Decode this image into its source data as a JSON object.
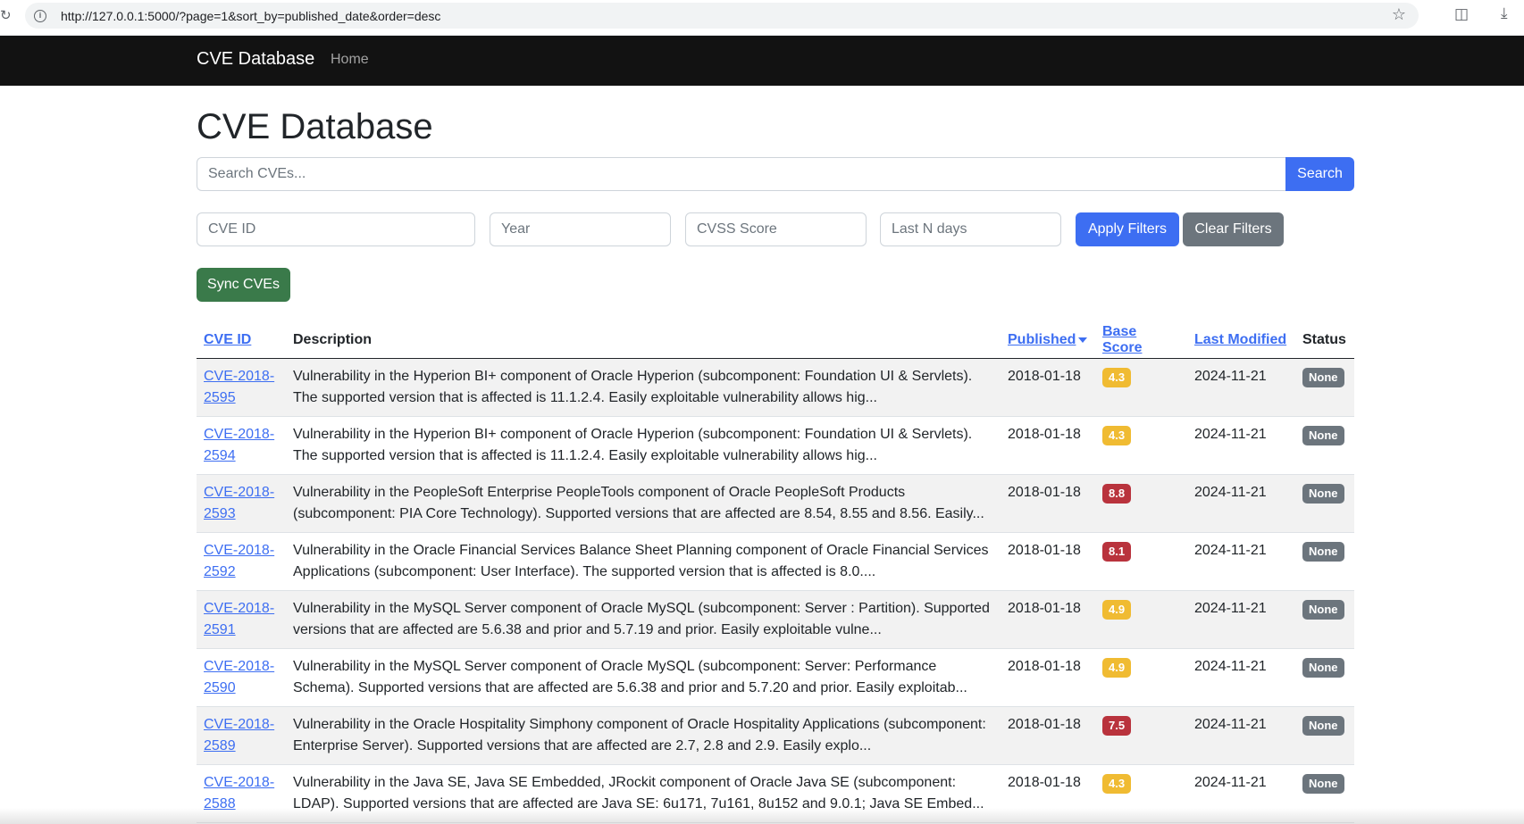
{
  "browser": {
    "url": "http://127.0.0.1:5000/?page=1&sort_by=published_date&order=desc"
  },
  "navbar": {
    "brand": "CVE Database",
    "home": "Home"
  },
  "page": {
    "title": "CVE Database"
  },
  "search": {
    "placeholder": "Search CVEs...",
    "button": "Search"
  },
  "filters": {
    "cve_id_placeholder": "CVE ID",
    "year_placeholder": "Year",
    "cvss_placeholder": "CVSS Score",
    "days_placeholder": "Last N days",
    "apply": "Apply Filters",
    "clear": "Clear Filters"
  },
  "sync": {
    "label": "Sync CVEs"
  },
  "table": {
    "headers": {
      "cve_id": "CVE ID",
      "description": "Description",
      "published": "Published",
      "base_score": "Base Score",
      "last_modified": "Last Modified",
      "status": "Status"
    },
    "rows": [
      {
        "id_a": "CVE-2018-",
        "id_b": "2595",
        "description": "Vulnerability in the Hyperion BI+ component of Oracle Hyperion (subcomponent: Foundation UI & Servlets). The supported version that is affected is 11.1.2.4. Easily exploitable vulnerability allows hig...",
        "published": "2018-01-18",
        "score": "4.3",
        "severity": "warn",
        "modified": "2024-11-21",
        "status": "None"
      },
      {
        "id_a": "CVE-2018-",
        "id_b": "2594",
        "description": "Vulnerability in the Hyperion BI+ component of Oracle Hyperion (subcomponent: Foundation UI & Servlets). The supported version that is affected is 11.1.2.4. Easily exploitable vulnerability allows hig...",
        "published": "2018-01-18",
        "score": "4.3",
        "severity": "warn",
        "modified": "2024-11-21",
        "status": "None"
      },
      {
        "id_a": "CVE-2018-",
        "id_b": "2593",
        "description": "Vulnerability in the PeopleSoft Enterprise PeopleTools component of Oracle PeopleSoft Products (subcomponent: PIA Core Technology). Supported versions that are affected are 8.54, 8.55 and 8.56. Easily...",
        "published": "2018-01-18",
        "score": "8.8",
        "severity": "danger",
        "modified": "2024-11-21",
        "status": "None"
      },
      {
        "id_a": "CVE-2018-",
        "id_b": "2592",
        "description": "Vulnerability in the Oracle Financial Services Balance Sheet Planning component of Oracle Financial Services Applications (subcomponent: User Interface). The supported version that is affected is 8.0....",
        "published": "2018-01-18",
        "score": "8.1",
        "severity": "danger",
        "modified": "2024-11-21",
        "status": "None"
      },
      {
        "id_a": "CVE-2018-",
        "id_b": "2591",
        "description": "Vulnerability in the MySQL Server component of Oracle MySQL (subcomponent: Server : Partition). Supported versions that are affected are 5.6.38 and prior and 5.7.19 and prior. Easily exploitable vulne...",
        "published": "2018-01-18",
        "score": "4.9",
        "severity": "warn",
        "modified": "2024-11-21",
        "status": "None"
      },
      {
        "id_a": "CVE-2018-",
        "id_b": "2590",
        "description": "Vulnerability in the MySQL Server component of Oracle MySQL (subcomponent: Server: Performance Schema). Supported versions that are affected are 5.6.38 and prior and 5.7.20 and prior. Easily exploitab...",
        "published": "2018-01-18",
        "score": "4.9",
        "severity": "warn",
        "modified": "2024-11-21",
        "status": "None"
      },
      {
        "id_a": "CVE-2018-",
        "id_b": "2589",
        "description": "Vulnerability in the Oracle Hospitality Simphony component of Oracle Hospitality Applications (subcomponent: Enterprise Server). Supported versions that are affected are 2.7, 2.8 and 2.9. Easily explo...",
        "published": "2018-01-18",
        "score": "7.5",
        "severity": "danger",
        "modified": "2024-11-21",
        "status": "None"
      },
      {
        "id_a": "CVE-2018-",
        "id_b": "2588",
        "description": "Vulnerability in the Java SE, Java SE Embedded, JRockit component of Oracle Java SE (subcomponent: LDAP). Supported versions that are affected are Java SE: 6u171, 7u161, 8u152 and 9.0.1; Java SE Embed...",
        "published": "2018-01-18",
        "score": "4.3",
        "severity": "warn",
        "modified": "2024-11-21",
        "status": "None"
      }
    ]
  },
  "colors": {
    "primary": "#3d6ef2",
    "navbar": "#121212",
    "success": "#3a7a4a",
    "secondary": "#6c757d",
    "warning": "#f0bb32",
    "danger": "#b9333d"
  }
}
